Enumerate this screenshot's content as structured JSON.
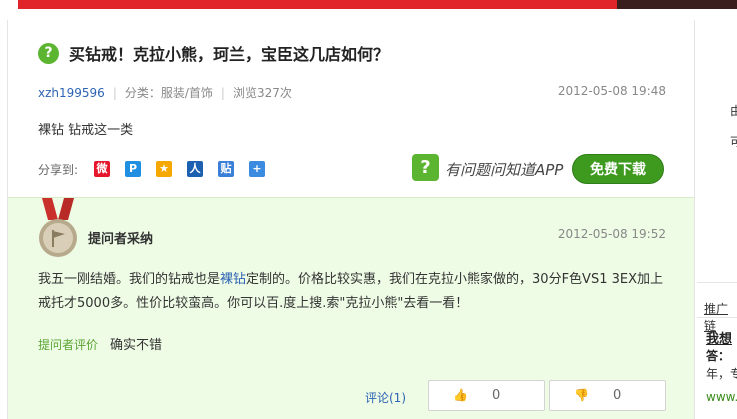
{
  "colors": {
    "accent_green": "#5cb531",
    "link_blue": "#2d64b3",
    "answer_bg": "#eefbe5",
    "banner_red": "#e0242a"
  },
  "question": {
    "icon": "question-mark-icon",
    "icon_glyph": "?",
    "title": "买钻戒！克拉小熊，珂兰，宝臣这几店如何？",
    "user": "xzh199596",
    "category": "分类：服装/首饰",
    "views": "浏览327次",
    "date": "2012-05-08 19:48",
    "body": "裸钻 钻戒这一类"
  },
  "share": {
    "label": "分享到:",
    "icons": [
      "weibo-icon",
      "qzone-icon",
      "star-icon",
      "renren-icon",
      "tieba-icon",
      "plus-icon"
    ]
  },
  "app_promo": {
    "icon_glyph": "?",
    "text": "有问题问知道APP",
    "button": "免费下载"
  },
  "answer": {
    "title": "提问者采纳",
    "date": "2012-05-08 19:52",
    "body_before": "我五一刚结婚。我们的钻戒也是",
    "body_keyword": "裸钻",
    "body_after": "定制的。价格比较实惠，我们在克拉小熊家做的，30分F色VS1 3EX加上戒托才5000多。性价比较蛮高。你可以百.度上搜.索\"克拉小熊\"去看一看！",
    "eval_label": "提问者评价",
    "eval_text": "确实不错",
    "comment_link": "评论(1)",
    "upvotes": "0",
    "downvotes": "0"
  },
  "sidebar": {
    "char1": "由",
    "char2": "可",
    "promo_label": "推广链",
    "link_title": "我想",
    "answer_prefix": "答：",
    "answer_text": "年，专",
    "url_text": "www."
  }
}
